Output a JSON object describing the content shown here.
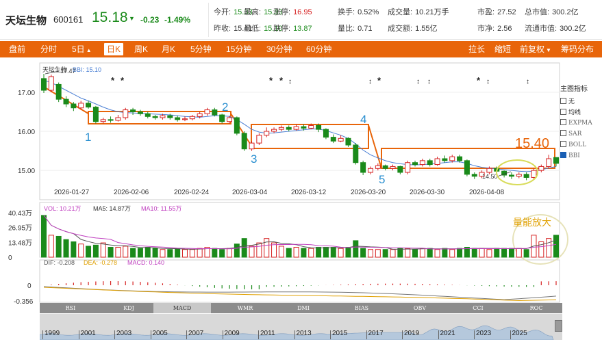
{
  "stock": {
    "name": "天坛生物",
    "code": "600161",
    "price": "15.18",
    "change": "-0.23",
    "change_pct": "-1.49%"
  },
  "quote": [
    {
      "label": "今开:",
      "value": "15.33",
      "tone": "green"
    },
    {
      "label": "最高:",
      "value": "15.33",
      "tone": "green"
    },
    {
      "label": "涨停:",
      "value": "16.95",
      "tone": "red"
    },
    {
      "label": "换手:",
      "value": "0.52%",
      "tone": "dark"
    },
    {
      "label": "成交量:",
      "value": "10.21万手",
      "tone": "dark"
    },
    {
      "label": "市盈:",
      "value": "27.52",
      "tone": "dark"
    },
    {
      "label": "总市值:",
      "value": "300.2亿",
      "tone": "dark"
    },
    {
      "label": "昨收:",
      "value": "15.41",
      "tone": "dark"
    },
    {
      "label": "最低:",
      "value": "15.10",
      "tone": "green"
    },
    {
      "label": "跌停:",
      "value": "13.87",
      "tone": "green"
    },
    {
      "label": "量比:",
      "value": "0.71",
      "tone": "dark"
    },
    {
      "label": "成交额:",
      "value": "1.55亿",
      "tone": "dark"
    },
    {
      "label": "市净:",
      "value": "2.56",
      "tone": "dark"
    },
    {
      "label": "流通市值:",
      "value": "300.2亿",
      "tone": "dark"
    }
  ],
  "tabs": [
    {
      "label": "盘前",
      "active": false,
      "caret": false
    },
    {
      "label": "分时",
      "active": false,
      "caret": false
    },
    {
      "label": "5日",
      "active": false,
      "caret": true
    },
    {
      "label": "日K",
      "active": true,
      "caret": false
    },
    {
      "label": "周K",
      "active": false,
      "caret": false
    },
    {
      "label": "月K",
      "active": false,
      "caret": false
    },
    {
      "label": "5分钟",
      "active": false,
      "caret": false
    },
    {
      "label": "15分钟",
      "active": false,
      "caret": false
    },
    {
      "label": "30分钟",
      "active": false,
      "caret": false
    },
    {
      "label": "60分钟",
      "active": false,
      "caret": false
    }
  ],
  "tabs_right": [
    {
      "label": "拉长",
      "caret": false
    },
    {
      "label": "缩短",
      "caret": false
    },
    {
      "label": "前复权",
      "caret": true
    },
    {
      "label": "筹码分布",
      "caret": false
    }
  ],
  "kline": {
    "title": "天坛生物",
    "bbi_label": "BBI: 15.10",
    "y_ticks": [
      "17.00",
      "16.00",
      "15.00"
    ],
    "x_dates": [
      "2026-01-27",
      "2026-02-06",
      "2026-02-24",
      "2026-03-04",
      "2026-03-12",
      "2026-03-20",
      "2026-03-30",
      "2026-04-08"
    ],
    "high_label": "17.47",
    "low_label": "14.50",
    "annotations": [
      "1",
      "2",
      "3",
      "4",
      "5"
    ],
    "price_note": "15.40",
    "candles": [
      [
        17.35,
        17.05,
        17.47,
        16.98
      ],
      [
        17.05,
        17.4,
        17.45,
        17.0
      ],
      [
        17.2,
        16.82,
        17.25,
        16.75
      ],
      [
        16.82,
        16.7,
        16.9,
        16.62
      ],
      [
        16.7,
        16.6,
        16.75,
        16.52
      ],
      [
        16.6,
        16.72,
        16.78,
        16.55
      ],
      [
        16.72,
        16.62,
        16.78,
        16.58
      ],
      [
        16.62,
        16.25,
        16.65,
        16.2
      ],
      [
        16.25,
        16.3,
        16.35,
        16.2
      ],
      [
        16.3,
        16.28,
        16.38,
        16.22
      ],
      [
        16.28,
        16.35,
        16.42,
        16.25
      ],
      [
        16.35,
        16.55,
        16.6,
        16.3
      ],
      [
        16.55,
        16.5,
        16.6,
        16.42
      ],
      [
        16.5,
        16.45,
        16.55,
        16.4
      ],
      [
        16.45,
        16.38,
        16.5,
        16.33
      ],
      [
        16.38,
        16.35,
        16.42,
        16.3
      ],
      [
        16.35,
        16.4,
        16.45,
        16.3
      ],
      [
        16.4,
        16.35,
        16.45,
        16.3
      ],
      [
        16.35,
        16.3,
        16.4,
        16.25
      ],
      [
        16.3,
        16.32,
        16.38,
        16.26
      ],
      [
        16.32,
        16.38,
        16.42,
        16.28
      ],
      [
        16.38,
        16.45,
        16.5,
        16.33
      ],
      [
        16.45,
        16.55,
        16.6,
        16.4
      ],
      [
        16.55,
        16.42,
        16.6,
        16.38
      ],
      [
        16.42,
        16.25,
        16.45,
        16.2
      ],
      [
        16.25,
        16.35,
        16.4,
        16.2
      ],
      [
        16.35,
        15.95,
        16.38,
        15.9
      ],
      [
        15.95,
        15.55,
        16.0,
        15.5
      ],
      [
        15.55,
        15.7,
        15.75,
        15.5
      ],
      [
        15.7,
        15.9,
        15.95,
        15.65
      ],
      [
        15.9,
        16.0,
        16.1,
        15.85
      ],
      [
        16.0,
        16.05,
        16.1,
        15.95
      ],
      [
        16.05,
        16.1,
        16.15,
        16.0
      ],
      [
        16.1,
        16.05,
        16.15,
        16.0
      ],
      [
        16.05,
        16.12,
        16.18,
        16.02
      ],
      [
        16.12,
        16.08,
        16.18,
        16.02
      ],
      [
        16.08,
        16.15,
        16.2,
        16.05
      ],
      [
        16.15,
        16.05,
        16.2,
        15.98
      ],
      [
        16.05,
        15.85,
        16.08,
        15.8
      ],
      [
        15.85,
        15.75,
        15.92,
        15.7
      ],
      [
        15.75,
        15.82,
        15.9,
        15.72
      ],
      [
        15.82,
        15.65,
        15.85,
        15.6
      ],
      [
        15.65,
        15.2,
        15.7,
        15.15
      ],
      [
        15.2,
        14.95,
        15.25,
        14.88
      ],
      [
        14.95,
        15.05,
        15.1,
        14.9
      ],
      [
        15.05,
        15.12,
        15.18,
        15.0
      ],
      [
        15.12,
        15.05,
        15.15,
        15.0
      ],
      [
        15.05,
        15.1,
        15.15,
        15.0
      ],
      [
        15.1,
        14.95,
        15.12,
        14.9
      ],
      [
        14.95,
        15.2,
        15.25,
        14.9
      ],
      [
        15.2,
        15.15,
        15.25,
        15.1
      ],
      [
        15.15,
        15.25,
        15.3,
        15.1
      ],
      [
        15.25,
        15.15,
        15.3,
        15.1
      ],
      [
        15.15,
        15.3,
        15.35,
        15.12
      ],
      [
        15.3,
        15.25,
        15.38,
        15.2
      ],
      [
        15.25,
        15.35,
        15.4,
        15.2
      ],
      [
        15.35,
        15.25,
        15.4,
        15.2
      ],
      [
        15.25,
        14.9,
        15.28,
        14.85
      ],
      [
        14.9,
        14.85,
        14.95,
        14.78
      ],
      [
        14.85,
        14.95,
        15.0,
        14.8
      ],
      [
        14.95,
        15.05,
        15.1,
        14.9
      ],
      [
        15.05,
        14.98,
        15.1,
        14.92
      ],
      [
        14.98,
        14.88,
        15.0,
        14.82
      ],
      [
        14.88,
        14.85,
        14.95,
        14.78
      ],
      [
        14.85,
        14.9,
        14.95,
        14.8
      ],
      [
        14.9,
        14.82,
        14.95,
        14.75
      ],
      [
        14.82,
        15.0,
        15.05,
        14.78
      ],
      [
        15.0,
        15.1,
        15.15,
        14.95
      ],
      [
        15.1,
        15.3,
        15.4,
        15.05
      ],
      [
        15.33,
        15.18,
        15.33,
        15.1
      ]
    ],
    "bbi": [
      17.3,
      17.25,
      17.15,
      17.05,
      16.95,
      16.85,
      16.78,
      16.7,
      16.62,
      16.55,
      16.5,
      16.48,
      16.47,
      16.46,
      16.45,
      16.44,
      16.43,
      16.42,
      16.4,
      16.38,
      16.37,
      16.36,
      16.38,
      16.4,
      16.4,
      16.38,
      16.3,
      16.18,
      16.05,
      15.98,
      15.95,
      15.96,
      15.98,
      16.0,
      16.02,
      16.04,
      16.06,
      16.06,
      16.02,
      15.96,
      15.9,
      15.82,
      15.68,
      15.52,
      15.4,
      15.32,
      15.25,
      15.2,
      15.17,
      15.15,
      15.14,
      15.15,
      15.16,
      15.18,
      15.2,
      15.22,
      15.22,
      15.18,
      15.12,
      15.08,
      15.06,
      15.04,
      15.02,
      15.0,
      14.98,
      14.97,
      14.98,
      15.02,
      15.06,
      15.1
    ]
  },
  "volume": {
    "vol_label": "VOL: 10.21万",
    "ma5_label": "MA5: 14.87万",
    "ma10_label": "MA10: 11.55万",
    "y_ticks": [
      "40.43万",
      "26.95万",
      "13.48万",
      "0"
    ],
    "note": "量能放大",
    "values": [
      38,
      20,
      19,
      16,
      14,
      12,
      10,
      11,
      13,
      9,
      9,
      10,
      8,
      8,
      9,
      8,
      7,
      7,
      8,
      7,
      7,
      8,
      9,
      8,
      7,
      8,
      12,
      17,
      10,
      13,
      17,
      13,
      10,
      8,
      9,
      8,
      8,
      9,
      9,
      9,
      8,
      9,
      15,
      8,
      7,
      7,
      7,
      7,
      8,
      8,
      7,
      8,
      8,
      7,
      8,
      7,
      8,
      9,
      8,
      8,
      7,
      8,
      8,
      8,
      8,
      7,
      20,
      14,
      17,
      20,
      10
    ]
  },
  "macd": {
    "dif_label": "DIF: -0.208",
    "dea_label": "DEA: -0.278",
    "macd_label": "MACD: 0.140",
    "y_ticks": [
      "0",
      "-0.356"
    ]
  },
  "side_panel": {
    "title": "主图指标",
    "items": [
      {
        "label": "无",
        "checked": false
      },
      {
        "label": "均线",
        "checked": false
      },
      {
        "label": "EXPMA",
        "checked": false
      },
      {
        "label": "SAR",
        "checked": false
      },
      {
        "label": "BOLL",
        "checked": false
      },
      {
        "label": "BBI",
        "checked": true
      }
    ]
  },
  "indicator_tabs": [
    {
      "label": "RSI",
      "active": false
    },
    {
      "label": "KDJ",
      "active": false
    },
    {
      "label": "MACD",
      "active": true
    },
    {
      "label": "WMR",
      "active": false
    },
    {
      "label": "DMI",
      "active": false
    },
    {
      "label": "BIAS",
      "active": false
    },
    {
      "label": "OBV",
      "active": false
    },
    {
      "label": "CCI",
      "active": false
    },
    {
      "label": "ROC",
      "active": false
    }
  ],
  "years": [
    "1999",
    "2001",
    "2003",
    "2005",
    "2007",
    "2009",
    "2011",
    "2013",
    "2015",
    "2017",
    "2019",
    "2021",
    "2023",
    "2025"
  ],
  "colors": {
    "up": "#d62020",
    "down": "#1a8a1a",
    "accent": "#e8650a",
    "bbi": "#4a7fd4",
    "box": "#e8650a",
    "label_blue": "#2a8fd0",
    "ellipse": "#d8dc5a",
    "ma5": "#555555",
    "ma10": "#c040c0"
  }
}
